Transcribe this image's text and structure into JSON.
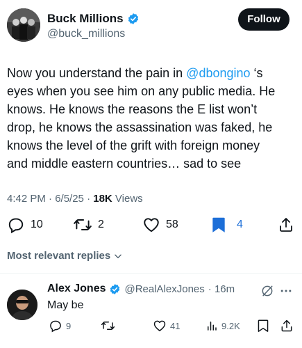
{
  "tweet": {
    "author": {
      "name": "Buck Millions",
      "handle": "@buck_millions",
      "verified": true
    },
    "follow_label": "Follow",
    "text_before": "Now you understand the pain in ",
    "mention": "@dbongino",
    "text_after": " ‘s\neyes when you see him on any public media. He\nknows. He knows the reasons the E list won’t\ndrop, he knows the assassination was faked, he\nknows the level of the grift with foreign money\nand middle eastern countries… sad to see",
    "time": "4:42 PM · 6/5/25 · ",
    "views_count": "18K",
    "views_label": " Views",
    "actions": {
      "replies": "10",
      "retweets": "2",
      "likes": "58",
      "bookmarks": "4"
    }
  },
  "replies_section": {
    "label": "Most relevant replies"
  },
  "reply": {
    "author": {
      "name": "Alex Jones",
      "handle": "@RealAlexJones",
      "time": "· 16m",
      "verified": true
    },
    "text": "May be",
    "actions": {
      "replies": "9",
      "likes": "41",
      "views": "9.2K"
    }
  },
  "colors": {
    "accent": "#1d9bf0",
    "text": "#0f1419",
    "secondary": "#536471",
    "bookmark_active": "#1d6fd8"
  },
  "icons": [
    "verified-badge-icon",
    "reply-icon",
    "retweet-icon",
    "like-icon",
    "bookmark-icon",
    "share-icon",
    "views-icon",
    "grok-icon",
    "more-icon",
    "chevron-down-icon"
  ]
}
